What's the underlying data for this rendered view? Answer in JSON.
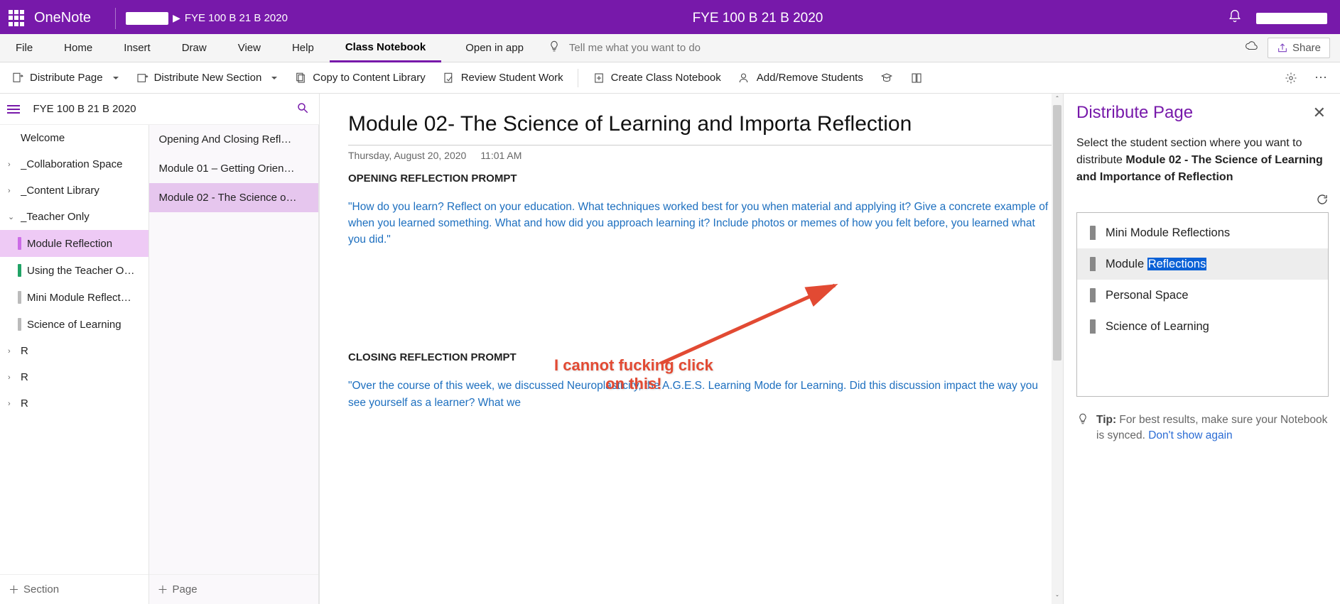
{
  "titlebar": {
    "app": "OneNote",
    "breadcrumb_link": "FYE 100 B 21 B 2020",
    "center": "FYE 100 B 21 B 2020"
  },
  "tabs": {
    "file": "File",
    "home": "Home",
    "insert": "Insert",
    "draw": "Draw",
    "view": "View",
    "help": "Help",
    "classnb": "Class Notebook",
    "openinapp": "Open in app",
    "tellme_placeholder": "Tell me what you want to do",
    "share": "Share"
  },
  "ribbon": {
    "distribute_page": "Distribute Page",
    "distribute_new_section": "Distribute New Section",
    "copy_library": "Copy to Content Library",
    "review_work": "Review Student Work",
    "create_classnb": "Create Class Notebook",
    "addremove_students": "Add/Remove Students"
  },
  "nav": {
    "notebook": "FYE 100 B 21 B 2020",
    "sections": {
      "welcome": "Welcome",
      "collab": "_Collaboration Space",
      "content": "_Content Library",
      "teacher": "_Teacher Only",
      "module_reflection": "Module Reflection",
      "using_teacher": "Using the Teacher O…",
      "mini_module": "Mini Module Reflect…",
      "sci_learn": "Science of Learning",
      "r1": "R",
      "r2": "R",
      "r3": "R"
    },
    "add_section": "Section",
    "add_page": "Page"
  },
  "pages": {
    "p0": "Opening And Closing Refl…",
    "p1": "Module 01 – Getting Orien…",
    "p2": "Module 02 - The Science o…"
  },
  "canvas": {
    "title": "Module 02- The Science of Learning and Importa Reflection",
    "date": "Thursday, August 20, 2020",
    "time": "11:01 AM",
    "h1": "OPENING REFLECTION PROMPT",
    "para1": "\"How do you learn? Reflect on your education. What techniques worked best for you when material and applying it? Give a concrete example of when you learned something. What and how did you approach learning it? Include photos or memes of how you felt before, you learned what you did.\"",
    "h2": "CLOSING REFLECTION PROMPT",
    "para2": "\"Over the course of this week, we discussed Neuroplasticity, the A.G.E.S. Learning Mode for Learning.  Did this discussion impact the way you see yourself as a learner?  What we"
  },
  "annotation": {
    "line1": "I cannot fucking click",
    "line2": "on this!"
  },
  "pane": {
    "title": "Distribute Page",
    "desc_pre": "Select the student section where you want to distribute ",
    "desc_bold": "Module 02 - The Science of Learning and Importance of Reflection",
    "items": {
      "i0": "Mini Module Reflections",
      "i1_pre": "Module ",
      "i1_hl": "Reflections",
      "i2": "Personal Space",
      "i3": "Science of Learning"
    },
    "tip_label": "Tip:",
    "tip_body": " For best results, make sure your Notebook is synced. ",
    "tip_link": "Don't show again"
  }
}
